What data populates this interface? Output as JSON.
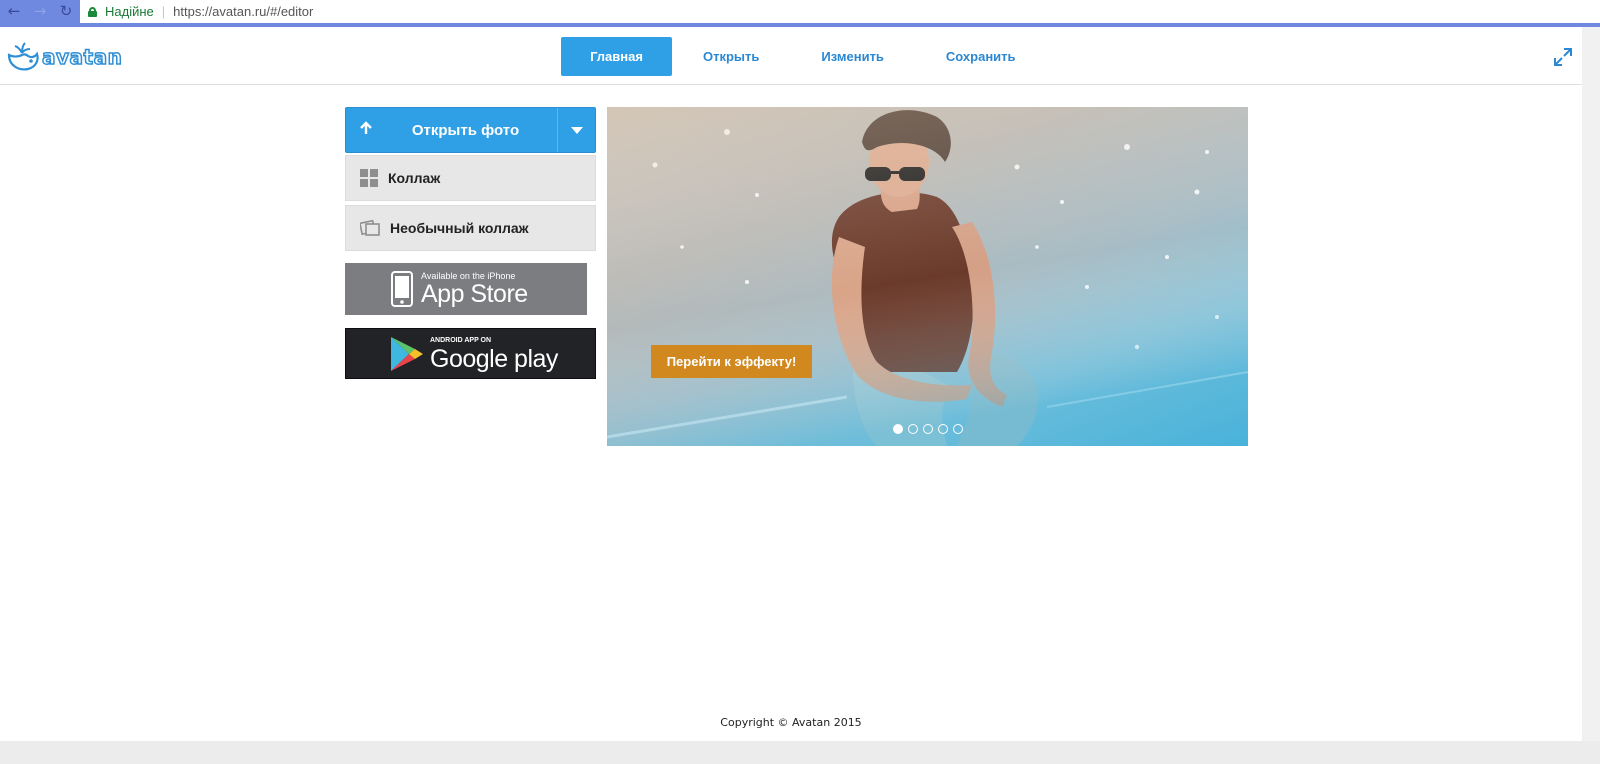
{
  "browser": {
    "back_glyph": "←",
    "forward_glyph": "→",
    "reload_glyph": "↻",
    "secure_label": "Надійне",
    "url": "https://avatan.ru/#/editor"
  },
  "header": {
    "logo_text": "avatan",
    "menu": [
      {
        "label": "Главная",
        "active": true
      },
      {
        "label": "Открыть",
        "active": false
      },
      {
        "label": "Изменить",
        "active": false
      },
      {
        "label": "Сохранить",
        "active": false
      }
    ]
  },
  "sidebar": {
    "open_photo_label": "Открыть фото",
    "collage_label": "Коллаж",
    "unusual_collage_label": "Необычный коллаж",
    "appstore": {
      "small": "Available on the iPhone",
      "big": "App Store"
    },
    "googleplay": {
      "small": "ANDROID APP ON",
      "big": "Google play"
    }
  },
  "slider": {
    "button_label": "Перейти к эффекту!",
    "slide_count": 5,
    "active_slide": 1
  },
  "footer": {
    "copyright": "Copyright © Avatan 2015"
  },
  "colors": {
    "accent_blue": "#2f9fe6",
    "link_blue": "#2c88d2",
    "effect_orange": "#d1891f",
    "chrome_blue": "#6f88e0"
  }
}
